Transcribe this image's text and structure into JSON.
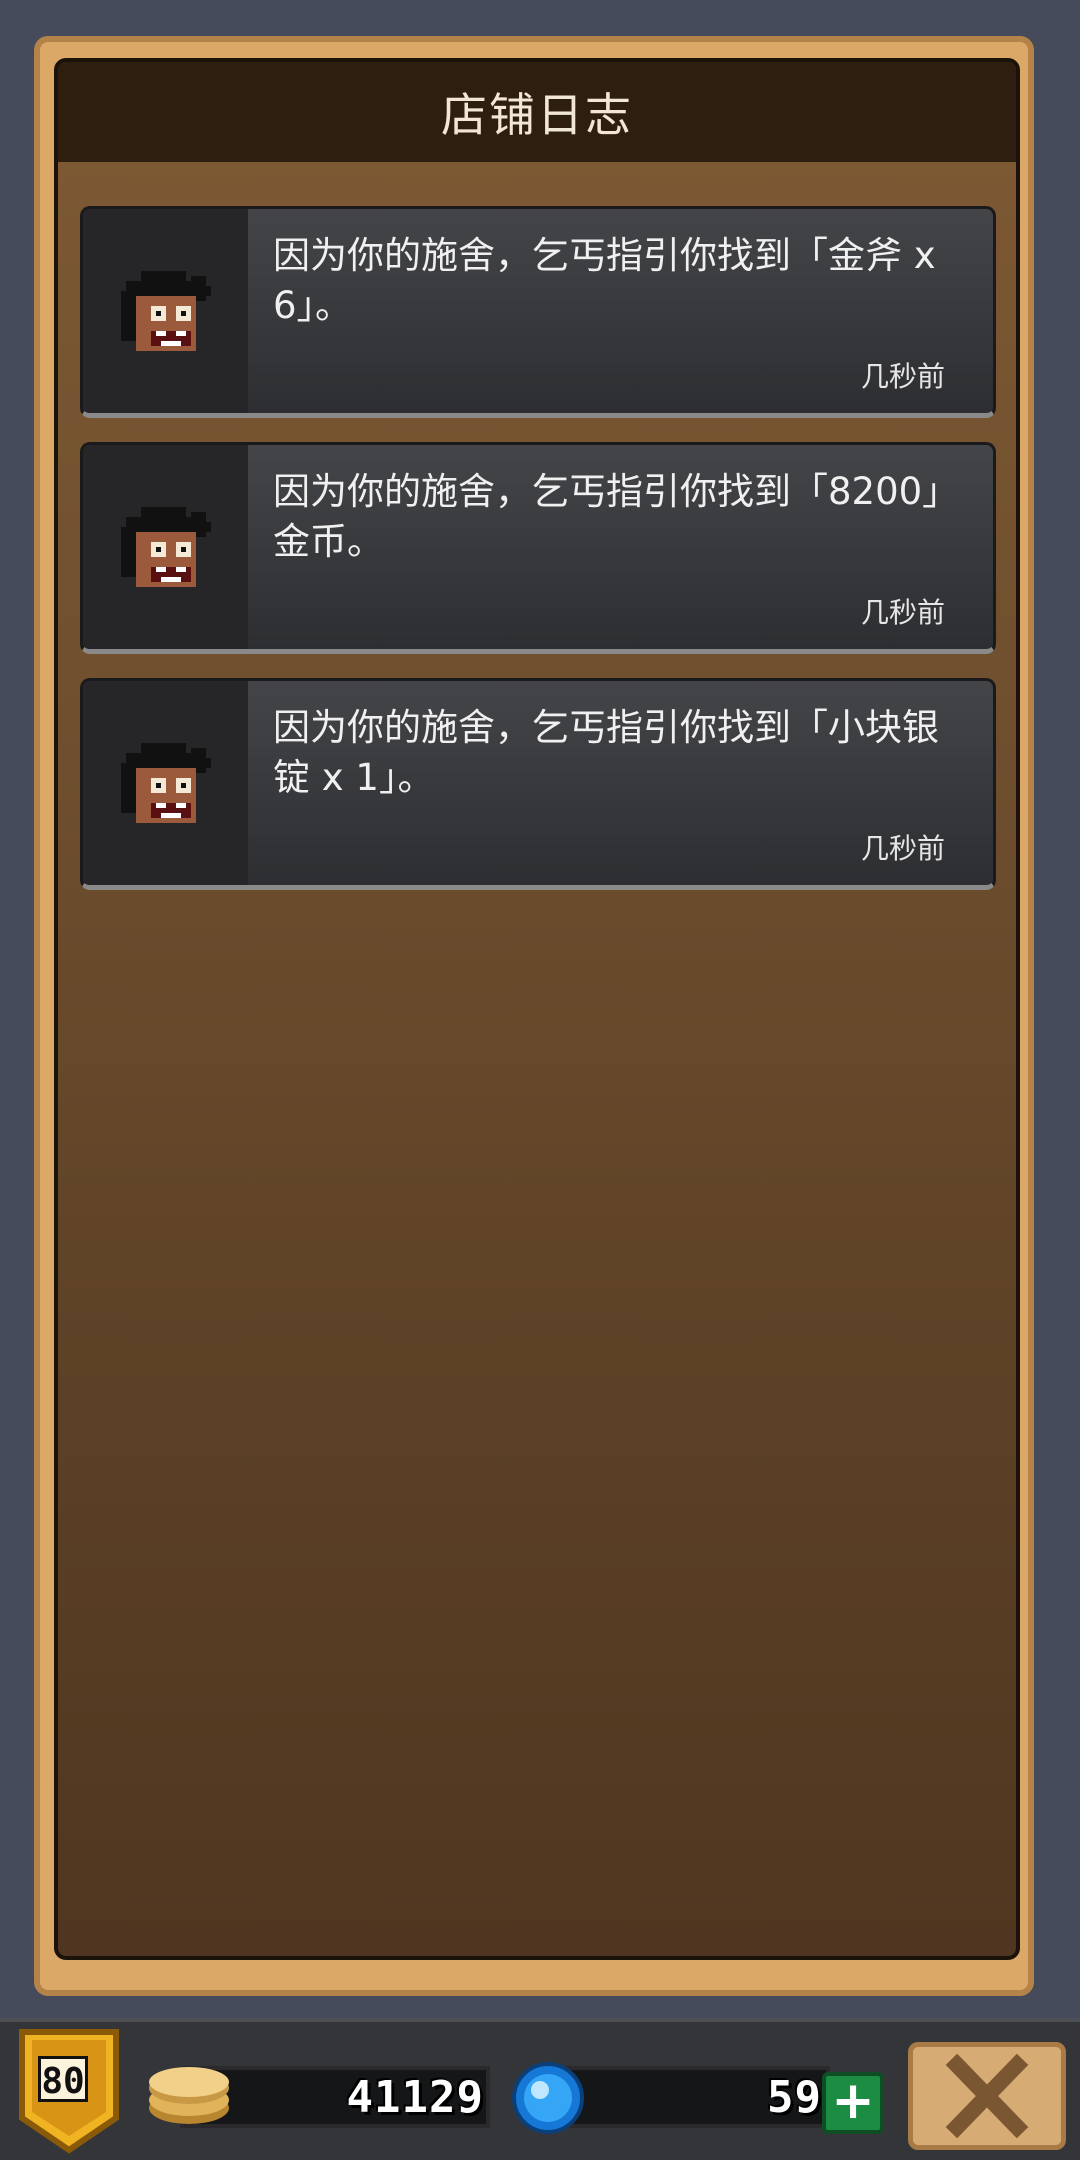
{
  "panel": {
    "title": "店铺日志"
  },
  "log": [
    {
      "text": "因为你的施舍，乞丐指引你找到「金斧 x 6」。",
      "time": "几秒前"
    },
    {
      "text": "因为你的施舍，乞丐指引你找到「8200」金币。",
      "time": "几秒前"
    },
    {
      "text": "因为你的施舍，乞丐指引你找到「小块银锭 x 1」。",
      "time": "几秒前"
    }
  ],
  "hud": {
    "level": "80",
    "gold": "41129",
    "gems": "59",
    "add_label": "+"
  },
  "icons": {
    "avatar": "beggar-face-icon",
    "gold": "gold-coins-icon",
    "gem": "blue-gem-icon",
    "add": "plus-icon",
    "close": "close-x-icon"
  }
}
